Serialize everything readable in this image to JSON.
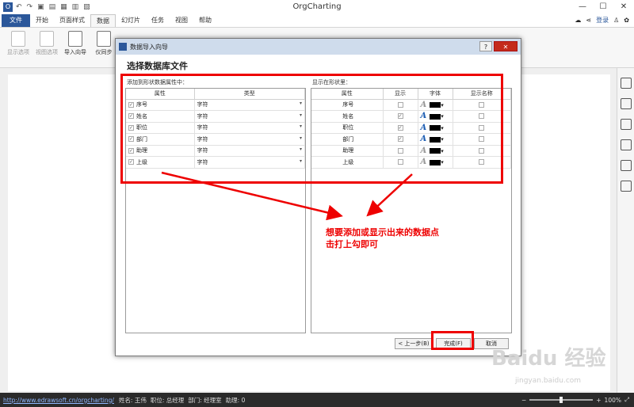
{
  "app": {
    "title": "OrgCharting"
  },
  "tabs": [
    "文件",
    "开始",
    "页面样式",
    "数据",
    "幻灯片",
    "任务",
    "视图",
    "帮助"
  ],
  "top_right": {
    "login": "登录"
  },
  "ribbon": {
    "buttons": [
      "显示选项",
      "视图选项",
      "导入向导",
      "仪同步"
    ]
  },
  "dialog": {
    "title": "数据导入向导",
    "heading": "选择数据库文件",
    "left_label": "添加到形状数据属性中：",
    "right_label": "显示在形状里：",
    "left_headers": [
      "属性",
      "类型"
    ],
    "right_headers": [
      "属性",
      "显示",
      "字体",
      "显示名称"
    ],
    "fields": [
      {
        "name": "序号",
        "type": "字符"
      },
      {
        "name": "姓名",
        "type": "字符"
      },
      {
        "name": "职位",
        "type": "字符"
      },
      {
        "name": "部门",
        "type": "字符"
      },
      {
        "name": "助理",
        "type": "字符"
      },
      {
        "name": "上级",
        "type": "字符"
      }
    ],
    "display": [
      {
        "name": "序号",
        "show": false
      },
      {
        "name": "姓名",
        "show": true
      },
      {
        "name": "职位",
        "show": true
      },
      {
        "name": "部门",
        "show": true
      },
      {
        "name": "助理",
        "show": false
      },
      {
        "name": "上级",
        "show": false
      }
    ],
    "font_glyph": "A",
    "check_mark": "✓",
    "buttons": {
      "back": "< 上一步(B)",
      "finish": "完成(F)",
      "cancel": "取消"
    }
  },
  "annotation": {
    "line1": "想要添加或显示出来的数据点",
    "line2": "击打上勾即可",
    "color": "#ee0000"
  },
  "statusbar": {
    "link": "http://www.edrawsoft.cn/orgcharting/",
    "items": [
      "姓名: 王伟",
      "职位: 总经理",
      "部门: 经理室",
      "助理: 0"
    ],
    "zoom": "100%"
  },
  "watermark": {
    "text": "Baidu 经验",
    "sub": "jingyan.baidu.com"
  }
}
